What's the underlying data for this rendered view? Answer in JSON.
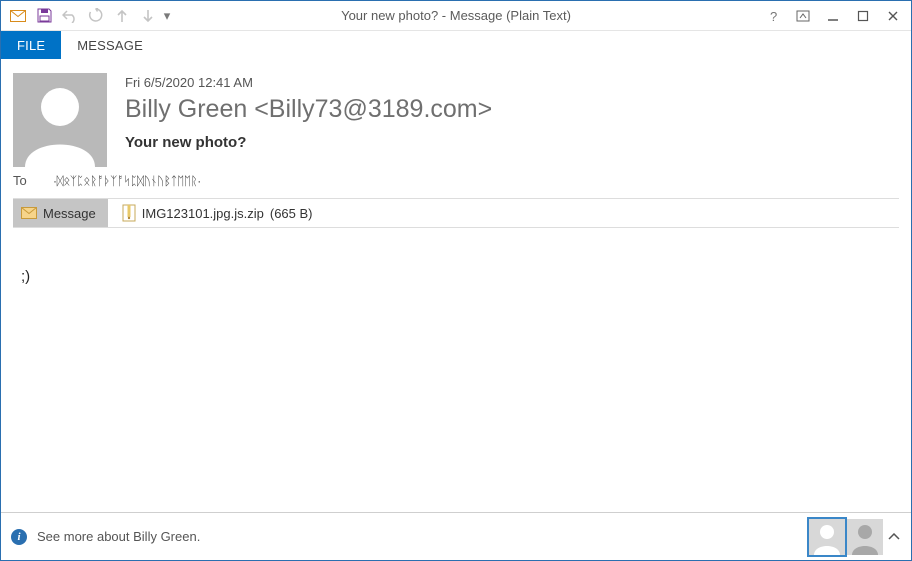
{
  "window": {
    "title": "Your new photo? - Message (Plain Text)"
  },
  "qat": {
    "customize_glyph": "▾"
  },
  "tabs": {
    "file": "FILE",
    "message": "MESSAGE"
  },
  "message": {
    "date": "Fri 6/5/2020 12:41 AM",
    "from": "Billy Green <Billy73@3189.com>",
    "subject": "Your new photo?",
    "to_label": "To",
    "to_value": "·ᛞᛟᛉᛈᛟᚱᚩᚦᛉᚩᛋᛈᛞᚢᚾᚢᛒᛏᛖᛖᚱ·",
    "body": ";)"
  },
  "attachment": {
    "tab_label": "Message",
    "filename": "IMG123101.jpg.js.zip",
    "size": "(665 B)"
  },
  "people": {
    "text": "See more about Billy Green."
  }
}
